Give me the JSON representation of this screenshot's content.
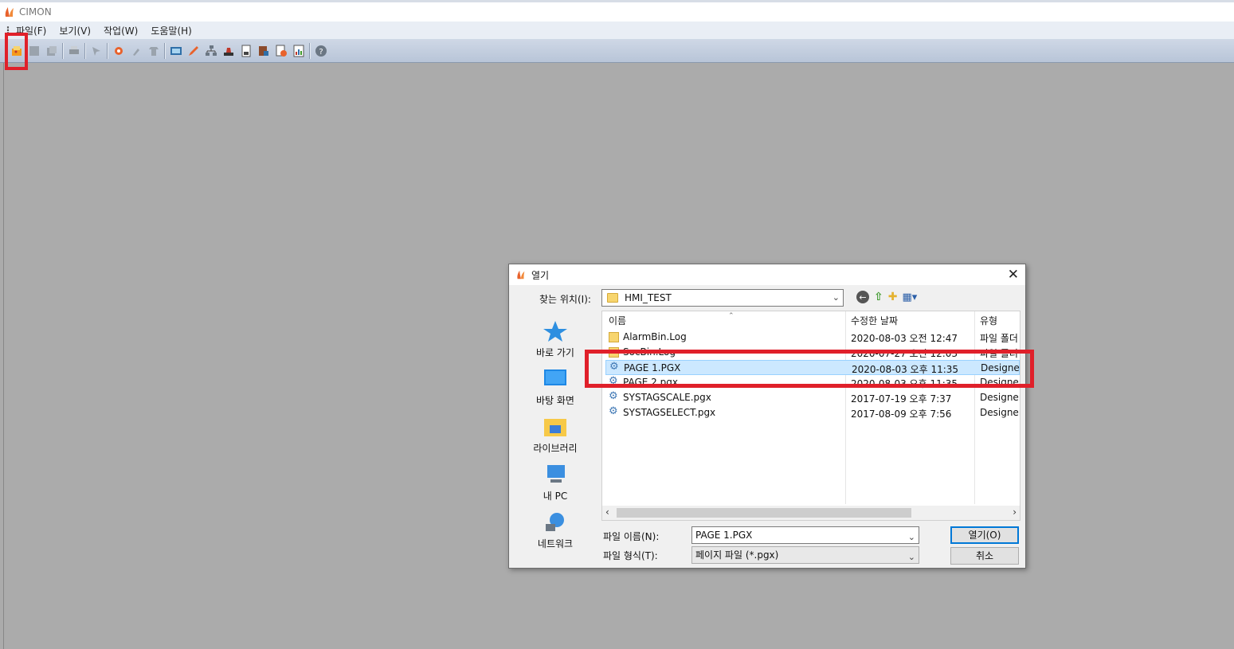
{
  "app": {
    "title": "CIMON"
  },
  "menu": [
    "파일(F)",
    "보기(V)",
    "작업(W)",
    "도움말(H)"
  ],
  "toolbar": {
    "groups": [
      [
        "open-icon",
        "save-icon",
        "save-all-icon"
      ],
      [
        "print-icon"
      ],
      [
        "select-icon"
      ],
      [
        "tag-icon",
        "tool-icon",
        "shirt-icon"
      ],
      [
        "screen-icon",
        "pencil-icon",
        "network-icon",
        "stamp-icon",
        "doc-icon",
        "db-icon",
        "add-page-icon",
        "report-icon"
      ],
      [
        "help-icon"
      ]
    ]
  },
  "dialog": {
    "title": "열기",
    "look_in_label": "찾는 위치(I):",
    "look_in_value": "HMI_TEST",
    "places": [
      "바로 가기",
      "바탕 화면",
      "라이브러리",
      "내 PC",
      "네트워크"
    ],
    "columns": {
      "name": "이름",
      "date": "수정한 날짜",
      "type": "유형"
    },
    "files": [
      {
        "name": "AlarmBin.Log",
        "date": "2020-08-03 오전 12:47",
        "type": "파일 폴더",
        "kind": "folder"
      },
      {
        "name": "SocBin.Log",
        "date": "2020-07-27 오전 12:03",
        "type": "파일 폴더",
        "kind": "folder"
      },
      {
        "name": "PAGE 1.PGX",
        "date": "2020-08-03 오후 11:35",
        "type": "Designer",
        "kind": "page",
        "selected": true
      },
      {
        "name": "PAGE 2.pgx",
        "date": "2020-08-03 오후 11:35",
        "type": "Designer",
        "kind": "page"
      },
      {
        "name": "SYSTAGSCALE.pgx",
        "date": "2017-07-19 오후 7:37",
        "type": "Designer",
        "kind": "page"
      },
      {
        "name": "SYSTAGSELECT.pgx",
        "date": "2017-08-09 오후 7:56",
        "type": "Designer",
        "kind": "page"
      }
    ],
    "file_name_label": "파일 이름(N):",
    "file_name_value": "PAGE 1.PGX",
    "file_type_label": "파일 형식(T):",
    "file_type_value": "페이지 파일 (*.pgx)",
    "open_button": "열기(O)",
    "cancel_button": "취소"
  },
  "colors": {
    "highlight": "#e0202a",
    "selection": "#cce8ff",
    "workspace": "#ababab"
  }
}
